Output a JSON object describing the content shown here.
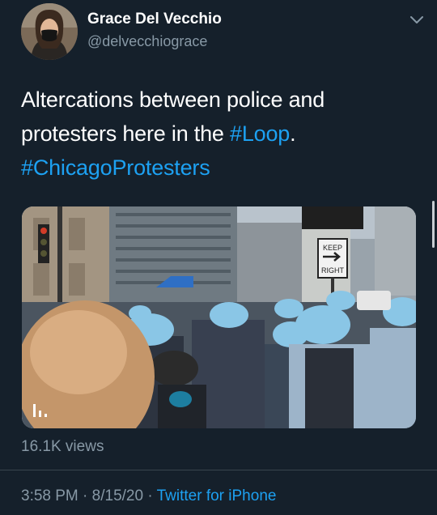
{
  "author": {
    "name": "Grace Del Vecchio",
    "handle": "@delvecchiograce"
  },
  "tweet": {
    "text_line1": "Altercations between police and",
    "text_line2_prefix": "protesters here in the ",
    "hashtag_loop": "#Loop",
    "text_line2_suffix": ".",
    "hashtag_chicago": "#ChicagoProtesters"
  },
  "media": {
    "sign_text_top": "KEEP",
    "sign_text_bottom": "RIGHT"
  },
  "stats": {
    "views": "16.1K views"
  },
  "meta": {
    "time": "3:58 PM",
    "separator1": " · ",
    "date": "8/15/20",
    "separator2": " · ",
    "source": "Twitter for iPhone"
  },
  "colors": {
    "background": "#15202b",
    "link": "#1da1f2",
    "secondary_text": "#8899a6"
  }
}
